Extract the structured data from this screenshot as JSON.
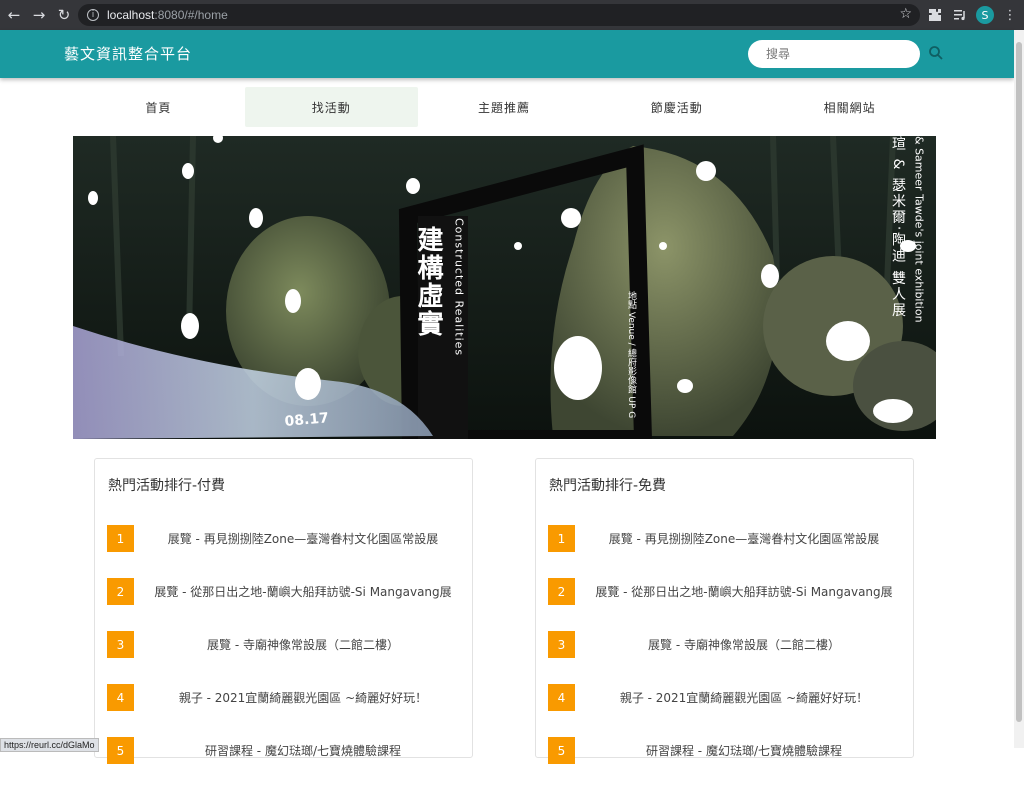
{
  "browser": {
    "url_host": "localhost",
    "url_rest": ":8080/#/home",
    "profile_initial": "S",
    "status_url": "https://reurl.cc/dGlaMo"
  },
  "header": {
    "title": "藝文資訊整合平台",
    "search_placeholder": "搜尋",
    "brand_color": "#1a9aa0"
  },
  "nav": {
    "items": [
      {
        "label": "首頁"
      },
      {
        "label": "找活動"
      },
      {
        "label": "主題推薦"
      },
      {
        "label": "節慶活動"
      },
      {
        "label": "相關網站"
      }
    ],
    "active_index": 1
  },
  "banner": {
    "title_zh": "建構虛實",
    "title_en": "Constructed Realities",
    "venue": "地點 Venue / 總府影像館 UP G",
    "date": "08.17",
    "right_line_1": "瑄 & 瑟米爾‧陶迪 雙人展",
    "right_line_2": "& Sameer Tawde's joint exhibition"
  },
  "rankings": [
    {
      "title": "熱門活動排行-付費",
      "items": [
        {
          "rank": "1",
          "text": "展覽 - 再見捌捌陸Zone—臺灣眷村文化園區常設展"
        },
        {
          "rank": "2",
          "text": "展覽 - 從那日出之地-蘭嶼大船拜訪號-Si Mangavang展"
        },
        {
          "rank": "3",
          "text": "展覽 - 寺廟神像常設展（二館二樓）"
        },
        {
          "rank": "4",
          "text": "親子 - 2021宜蘭綺麗觀光園區 ~綺麗好好玩！"
        },
        {
          "rank": "5",
          "text": "研習課程 - 魔幻琺瑯/七寶燒體驗課程"
        }
      ]
    },
    {
      "title": "熱門活動排行-免費",
      "items": [
        {
          "rank": "1",
          "text": "展覽 - 再見捌捌陸Zone—臺灣眷村文化園區常設展"
        },
        {
          "rank": "2",
          "text": "展覽 - 從那日出之地-蘭嶼大船拜訪號-Si Mangavang展"
        },
        {
          "rank": "3",
          "text": "展覽 - 寺廟神像常設展（二館二樓）"
        },
        {
          "rank": "4",
          "text": "親子 - 2021宜蘭綺麗觀光園區 ~綺麗好好玩！"
        },
        {
          "rank": "5",
          "text": "研習課程 - 魔幻琺瑯/七寶燒體驗課程"
        }
      ]
    }
  ]
}
